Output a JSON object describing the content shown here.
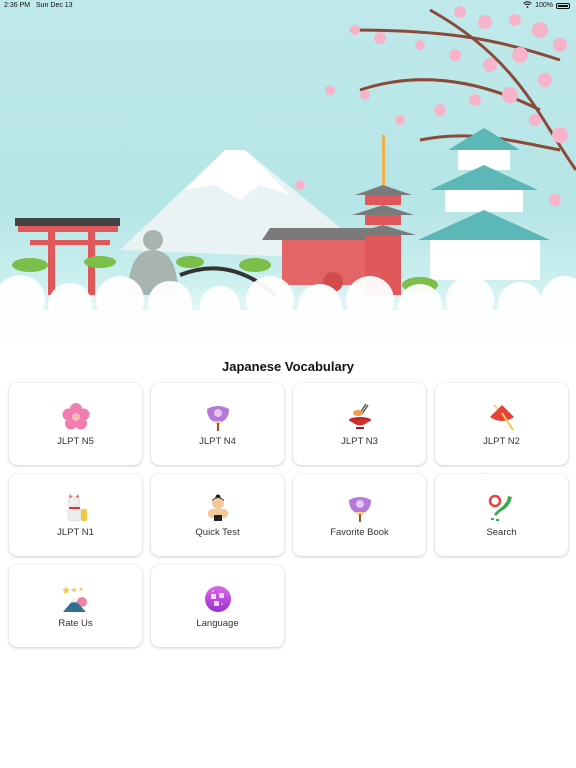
{
  "status_bar": {
    "time": "2:36 PM",
    "date": "Sun Dec 13",
    "battery": "100%",
    "wifi_icon": "wifi-icon",
    "battery_icon": "battery-icon"
  },
  "header": {
    "illustration": "japan-landmarks-banner",
    "title": "Japanese Vocabulary"
  },
  "menu": [
    {
      "label": "JLPT N5",
      "icon": "sakura-flower-icon"
    },
    {
      "label": "JLPT N4",
      "icon": "purple-fan-icon"
    },
    {
      "label": "JLPT N3",
      "icon": "sushi-bowl-icon"
    },
    {
      "label": "JLPT N2",
      "icon": "red-umbrella-icon"
    },
    {
      "label": "JLPT N1",
      "icon": "lucky-cat-icon"
    },
    {
      "label": "Quick Test",
      "icon": "sumo-icon"
    },
    {
      "label": "Favorite Book",
      "icon": "purple-fan-icon"
    },
    {
      "label": "Search",
      "icon": "japan-map-icon"
    },
    {
      "label": "Rate Us",
      "icon": "fuji-stars-icon"
    },
    {
      "label": "Language",
      "icon": "language-globe-icon"
    }
  ],
  "colors": {
    "sky": "#bfe9ea",
    "torii_red": "#e0585a",
    "sakura_pink": "#f4a6c0",
    "castle_teal": "#5bb8b6"
  }
}
